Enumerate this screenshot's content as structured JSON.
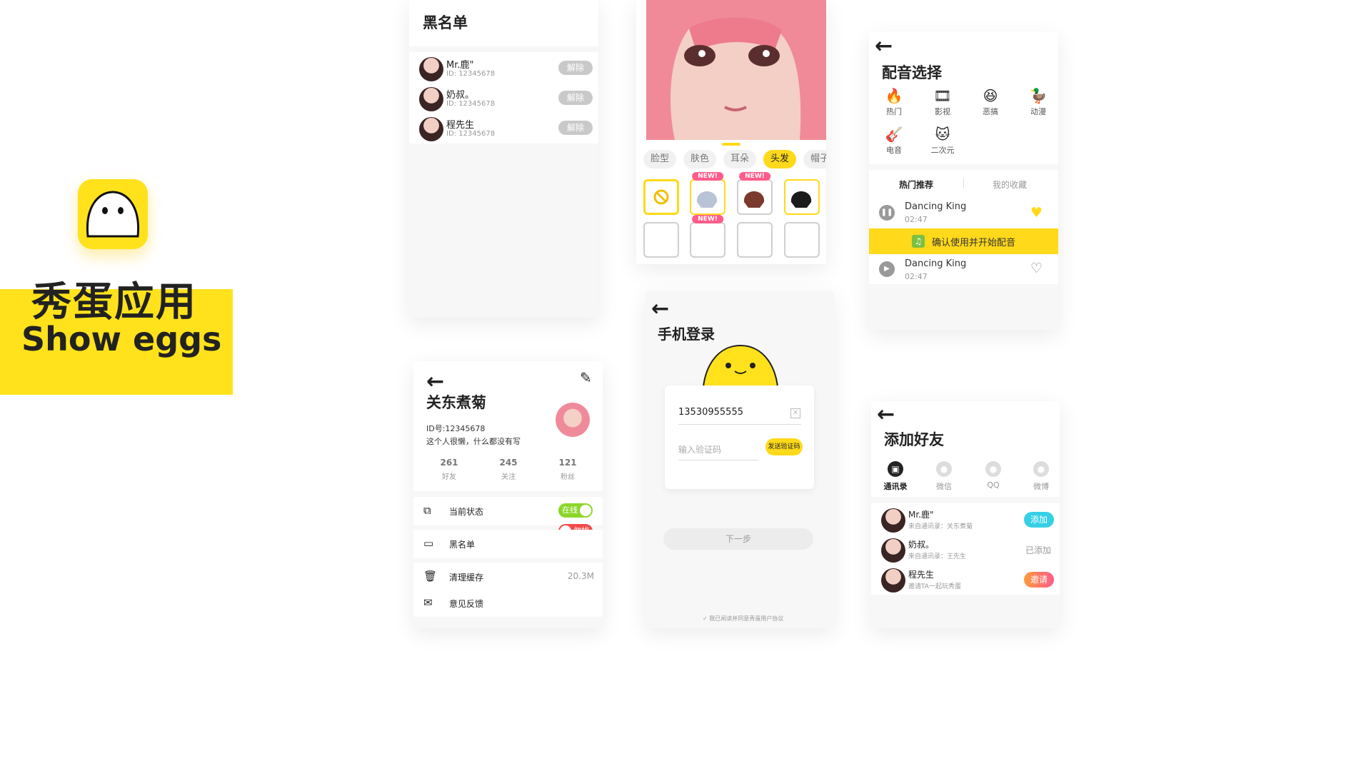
{
  "brand": {
    "cn_title": "秀蛋应用",
    "en_title": "Show eggs"
  },
  "blacklist": {
    "title": "黑名单",
    "items": [
      {
        "name": "Mr.鹿\"",
        "id": "ID: 12345678",
        "action": "解除"
      },
      {
        "name": "奶叔。",
        "id": "ID: 12345678",
        "action": "解除"
      },
      {
        "name": "程先生",
        "id": "ID: 12345678",
        "action": "解除"
      }
    ]
  },
  "avatar_editor": {
    "tabs": [
      "脸型",
      "肤色",
      "耳朵",
      "头发",
      "帽子"
    ],
    "active_tab": "头发",
    "new_tag": "NEW!"
  },
  "dubbing": {
    "title": "配音选择",
    "categories": [
      "热门",
      "影视",
      "恶搞",
      "动漫",
      "电音",
      "二次元"
    ],
    "tabs": [
      "热门推荐",
      "我的收藏"
    ],
    "tracks": [
      {
        "name": "Dancing King",
        "duration": "02:47"
      },
      {
        "name": "Dancing King",
        "duration": "02:47"
      }
    ],
    "confirm_label": "确认使用并开始配音"
  },
  "profile": {
    "name": "关东煮菊",
    "id": "ID号:12345678",
    "bio": "这个人很懒，什么都没有写",
    "stats": [
      {
        "value": "261",
        "label": "好友"
      },
      {
        "value": "245",
        "label": "关注"
      },
      {
        "value": "121",
        "label": "粉丝"
      }
    ],
    "menu": [
      {
        "label": "当前状态",
        "value": ""
      },
      {
        "label": "黑名单",
        "value": ""
      },
      {
        "label": "清理缓存",
        "value": "20.3M"
      },
      {
        "label": "意见反馈",
        "value": ""
      }
    ],
    "status_online": "在线",
    "status_dnd": "勿扰"
  },
  "login": {
    "title": "手机登录",
    "phone": "13530955555",
    "code_placeholder": "输入验证码",
    "send_code": "发送验证码",
    "next": "下一步",
    "agreement": "我已阅读并同意秀蛋用户协议"
  },
  "add_friend": {
    "title": "添加好友",
    "sources": [
      "通讯录",
      "微信",
      "QQ",
      "微博"
    ],
    "items": [
      {
        "name": "Mr.鹿\"",
        "sub": "来自通讯录：关东煮菊",
        "action": "添加"
      },
      {
        "name": "奶叔。",
        "sub": "来自通讯录：王先生",
        "action": "已添加"
      },
      {
        "name": "程先生",
        "sub": "邀请TA一起玩秀蛋",
        "action": "邀请"
      }
    ]
  },
  "colors": {
    "accent": "#FFD91A",
    "pink": "#FF5C8A",
    "green": "#8CD62A",
    "red": "#F24B4B",
    "cyan": "#35D0E6"
  }
}
